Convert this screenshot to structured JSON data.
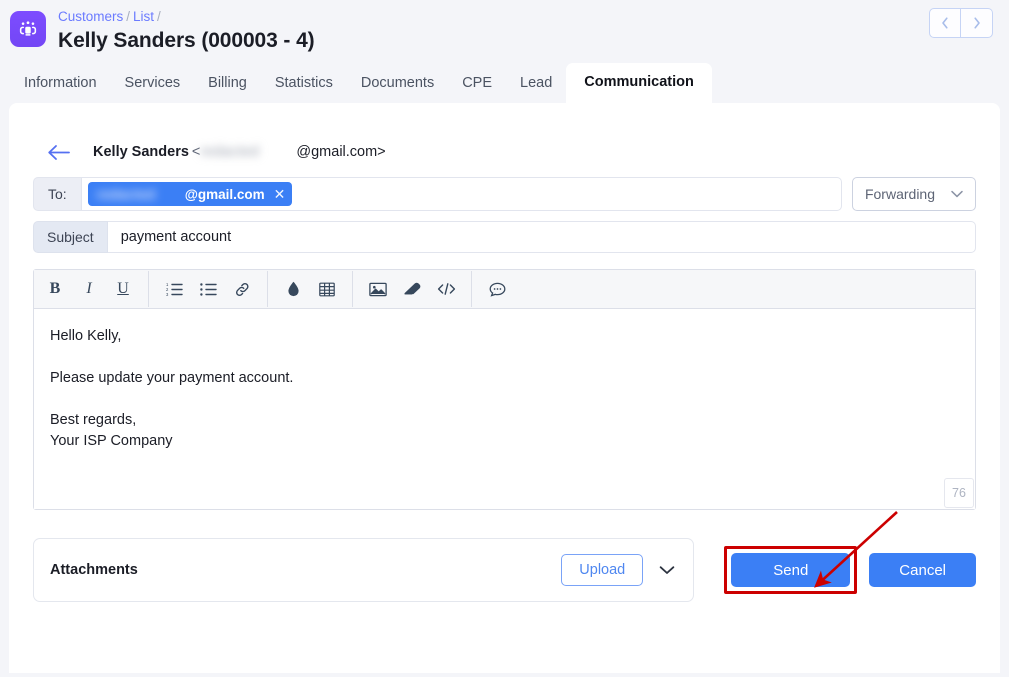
{
  "header": {
    "logo_icon": "customers-group-icon",
    "breadcrumb": [
      {
        "label": "Customers",
        "link": true
      },
      {
        "label": "List",
        "link": true
      }
    ],
    "breadcrumb_separator": "/",
    "page_title": "Kelly Sanders (000003 - 4)",
    "nav_prev_icon": "chevron-left-icon",
    "nav_next_icon": "chevron-right-icon"
  },
  "tabs": [
    {
      "label": "Information",
      "active": false
    },
    {
      "label": "Services",
      "active": false
    },
    {
      "label": "Billing",
      "active": false
    },
    {
      "label": "Statistics",
      "active": false
    },
    {
      "label": "Documents",
      "active": false
    },
    {
      "label": "CPE",
      "active": false
    },
    {
      "label": "Lead",
      "active": false
    },
    {
      "label": "Communication",
      "active": true
    }
  ],
  "compose": {
    "back_icon": "arrow-left-icon",
    "recipient_name": "Kelly Sanders",
    "recipient_angle_open": "<",
    "recipient_blurred": "redacted",
    "recipient_domain": "@gmail.com>",
    "to": {
      "label": "To:",
      "chip_blurred": "redacted",
      "chip_domain": "@gmail.com",
      "chip_remove_icon": "close-icon"
    },
    "forwarding": {
      "value": "Forwarding",
      "caret_icon": "chevron-down-icon"
    },
    "subject": {
      "label": "Subject",
      "value": "payment account",
      "placeholder": "Subject"
    },
    "toolbar": [
      {
        "name": "bold-icon",
        "glyph": "B",
        "type": "text",
        "weight": "bold"
      },
      {
        "name": "italic-icon",
        "glyph": "I",
        "type": "text",
        "weight": "italic"
      },
      {
        "name": "underline-icon",
        "glyph": "U",
        "type": "text",
        "weight": "underline"
      },
      {
        "name": "separator"
      },
      {
        "name": "ordered-list-icon"
      },
      {
        "name": "unordered-list-icon"
      },
      {
        "name": "link-icon"
      },
      {
        "name": "separator"
      },
      {
        "name": "color-droplet-icon"
      },
      {
        "name": "table-icon"
      },
      {
        "name": "separator"
      },
      {
        "name": "image-icon"
      },
      {
        "name": "eraser-icon"
      },
      {
        "name": "code-icon"
      },
      {
        "name": "separator"
      },
      {
        "name": "comment-icon"
      }
    ],
    "body_paragraphs": [
      "Hello Kelly,",
      "Please update your payment account.",
      "Best regards,"
    ],
    "body_signature": "Your ISP Company",
    "char_count": "76"
  },
  "bottom": {
    "attachments_label": "Attachments",
    "upload_label": "Upload",
    "upload_caret_icon": "chevron-down-icon",
    "send_label": "Send",
    "cancel_label": "Cancel"
  },
  "annotation": {
    "highlight_color": "#cc0000",
    "arrow_color": "#cc0000",
    "target": "send-button"
  },
  "colors": {
    "page_bg": "#f4f5f9",
    "accent_blue": "#3b7ff5",
    "logo_purple": "#7c4dff",
    "link_blue": "#6b7bff"
  }
}
